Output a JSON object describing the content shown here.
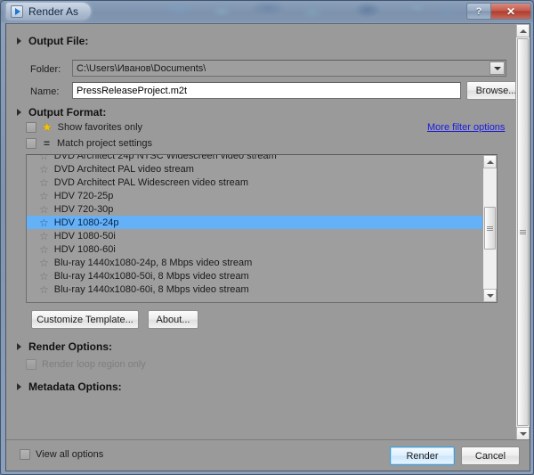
{
  "window": {
    "title": "Render As",
    "app_icon": "play-triangle-icon",
    "controls": {
      "help": "?",
      "close": "✕"
    }
  },
  "output_file": {
    "section_title": "Output File:",
    "folder_label": "Folder:",
    "folder_value": "C:\\Users\\Иванов\\Documents\\",
    "name_label": "Name:",
    "name_value": "PressReleaseProject.m2t",
    "browse_label": "Browse..."
  },
  "output_format": {
    "section_title": "Output Format:",
    "show_favorites_label": "Show favorites only",
    "show_favorites_checked": false,
    "match_project_label": "Match project settings",
    "match_project_checked": false,
    "more_filter_options": "More filter options",
    "favorites_icon": "star-icon",
    "match_icon": "equals-icon",
    "templates": [
      {
        "label": "DVD Architect 24p NTSC Widescreen video stream",
        "selected": false,
        "favorite": false
      },
      {
        "label": "DVD Architect PAL video stream",
        "selected": false,
        "favorite": false
      },
      {
        "label": "DVD Architect PAL Widescreen video stream",
        "selected": false,
        "favorite": false
      },
      {
        "label": "HDV 720-25p",
        "selected": false,
        "favorite": false
      },
      {
        "label": "HDV 720-30p",
        "selected": false,
        "favorite": false
      },
      {
        "label": "HDV 1080-24p",
        "selected": true,
        "favorite": false
      },
      {
        "label": "HDV 1080-50i",
        "selected": false,
        "favorite": false
      },
      {
        "label": "HDV 1080-60i",
        "selected": false,
        "favorite": false
      },
      {
        "label": "Blu-ray 1440x1080-24p, 8 Mbps video stream",
        "selected": false,
        "favorite": false
      },
      {
        "label": "Blu-ray 1440x1080-50i, 8 Mbps video stream",
        "selected": false,
        "favorite": false
      },
      {
        "label": "Blu-ray 1440x1080-60i, 8 Mbps video stream",
        "selected": false,
        "favorite": false
      }
    ],
    "customize_template_label": "Customize Template...",
    "about_label": "About..."
  },
  "render_options": {
    "section_title": "Render Options:",
    "render_loop_label": "Render loop region only",
    "render_loop_checked": false,
    "render_loop_disabled": true
  },
  "metadata_options": {
    "section_title": "Metadata Options:"
  },
  "footer": {
    "view_all_options_label": "View all options",
    "view_all_options_checked": false,
    "render_label": "Render",
    "cancel_label": "Cancel"
  },
  "colors": {
    "selection_blue": "#64b1f7",
    "link_blue": "#1c1ce0",
    "star_yellow": "#f2c30d",
    "dialog_gray": "#9a9a9a",
    "default_button_border": "#3c9ddd",
    "close_red": "#c4594b"
  }
}
